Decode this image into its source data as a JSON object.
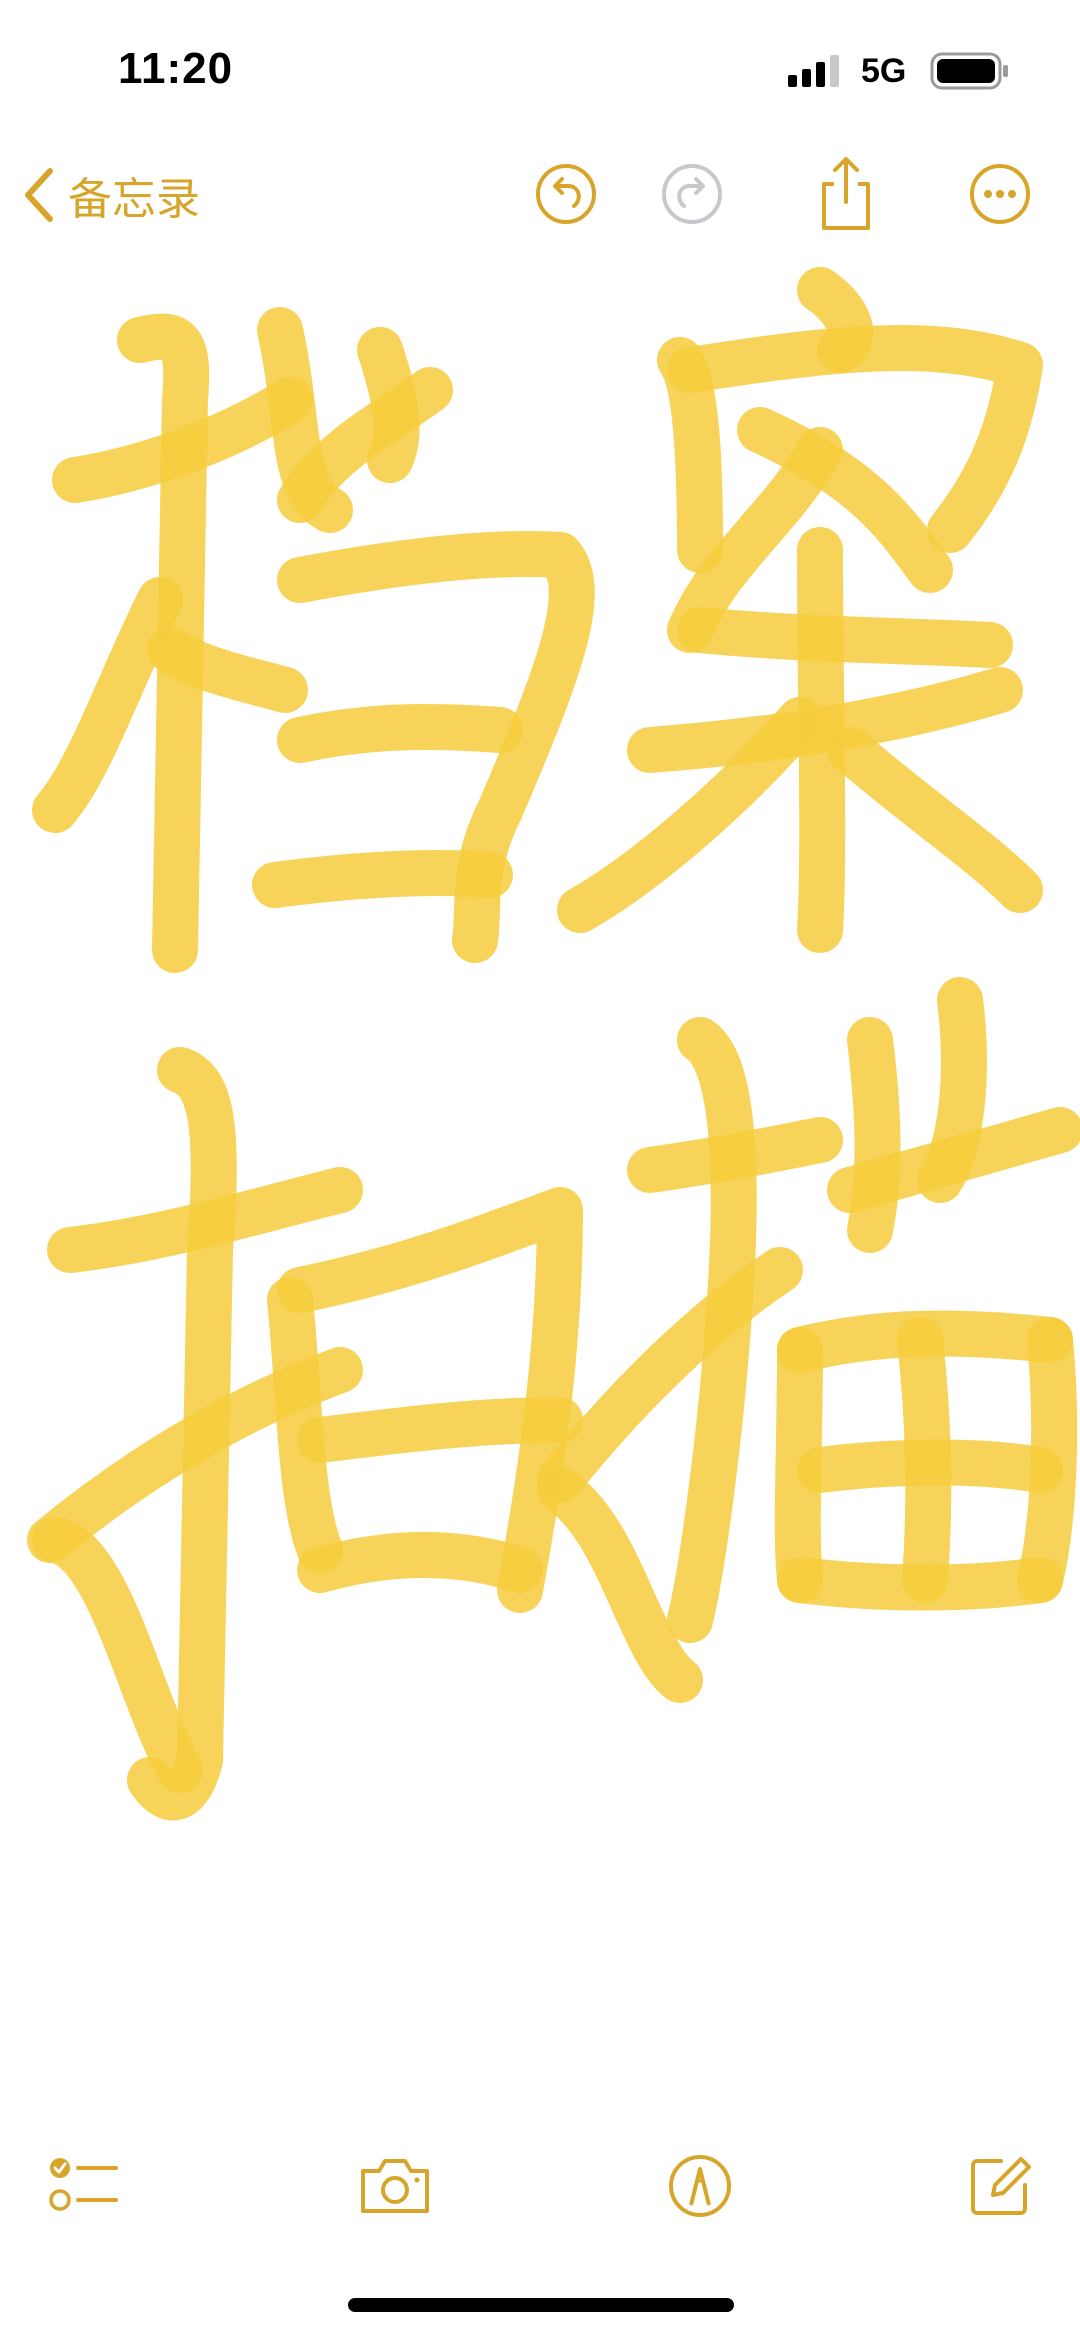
{
  "status_bar": {
    "time": "11:20",
    "network": "5G"
  },
  "nav": {
    "back_label": "备忘录"
  },
  "note": {
    "handwriting": [
      "档案",
      "扫描"
    ]
  },
  "colors": {
    "accent": "#d8a52b",
    "ink": "#f6cd3c",
    "disabled": "#c7c7cc"
  },
  "icons": {
    "back": "chevron-left-icon",
    "undo": "undo-icon",
    "redo": "redo-icon",
    "share": "share-icon",
    "more": "ellipsis-circle-icon",
    "checklist": "checklist-icon",
    "camera": "camera-icon",
    "markup": "markup-pen-icon",
    "compose": "compose-icon"
  }
}
